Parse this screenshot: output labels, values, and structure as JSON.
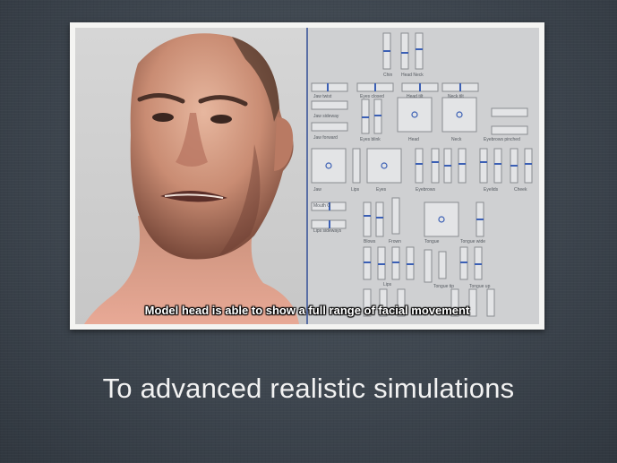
{
  "slide": {
    "caption": "Model head is able to show a full range of facial movement",
    "subtitle": "To advanced realistic simulations",
    "colors": {
      "background": "#3c444d",
      "frame": "#f4f4f2",
      "slider_accent": "#3b5fb4"
    },
    "image": {
      "subject": "3d-model-head",
      "panel": "facial-controls-panel"
    }
  }
}
